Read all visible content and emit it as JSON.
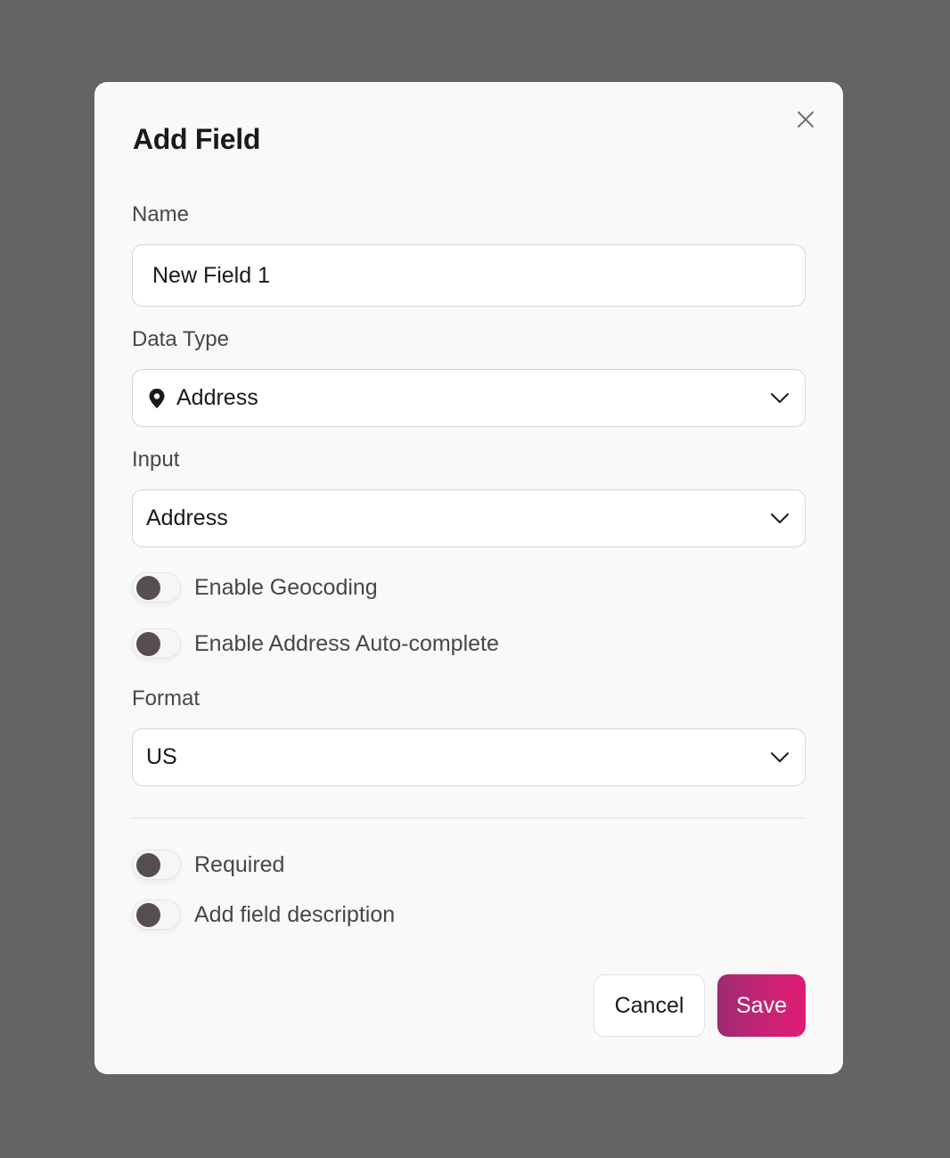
{
  "modal": {
    "title": "Add Field",
    "close_icon": "close-icon",
    "name": {
      "label": "Name",
      "value": "New Field 1"
    },
    "data_type": {
      "label": "Data Type",
      "value": "Address",
      "icon": "map-pin-icon"
    },
    "input": {
      "label": "Input",
      "value": "Address"
    },
    "toggles_top": [
      {
        "label": "Enable Geocoding",
        "on": false
      },
      {
        "label": "Enable Address Auto-complete",
        "on": false
      }
    ],
    "format": {
      "label": "Format",
      "value": "US"
    },
    "toggles_bottom": [
      {
        "label": "Required",
        "on": false
      },
      {
        "label": "Add field description",
        "on": false
      }
    ],
    "buttons": {
      "cancel": "Cancel",
      "save": "Save"
    }
  }
}
